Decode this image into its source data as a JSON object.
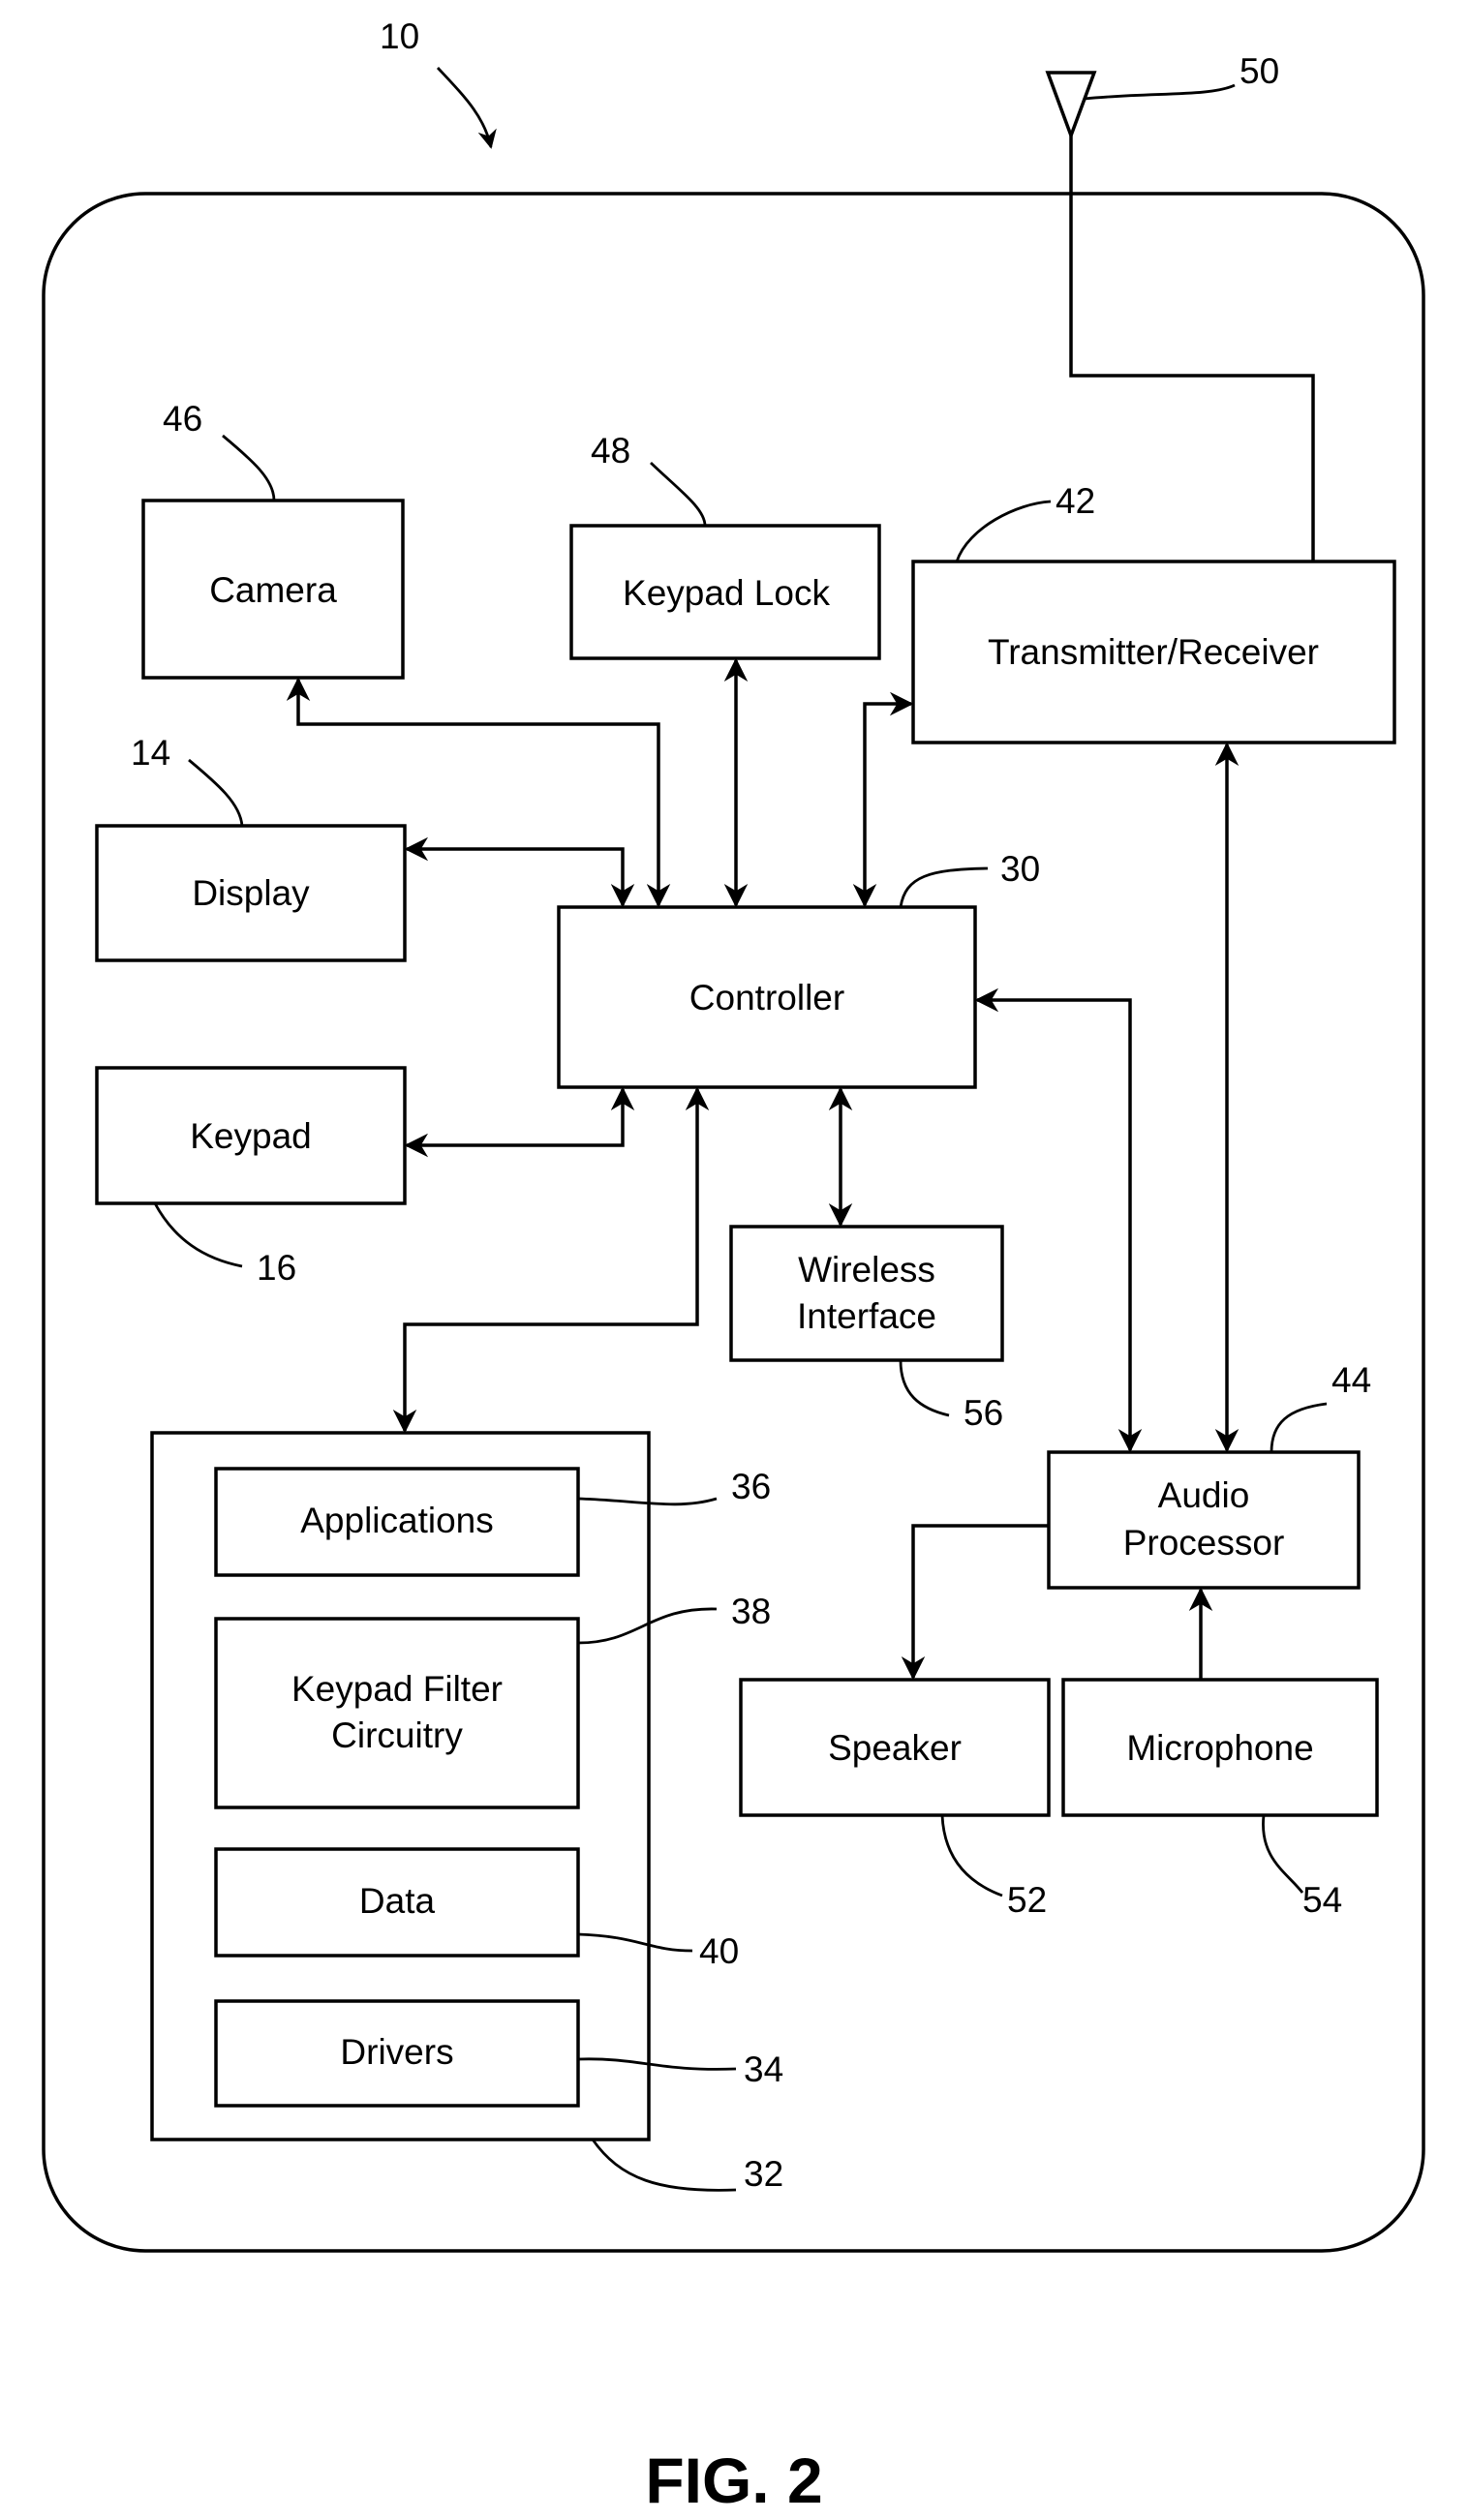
{
  "figure": {
    "caption": "FIG. 2",
    "device_ref": "10"
  },
  "antenna": {
    "ref": "50"
  },
  "blocks": {
    "camera": {
      "label": "Camera",
      "ref": "46"
    },
    "keypad_lock": {
      "label": "Keypad Lock",
      "ref": "48"
    },
    "transceiver": {
      "label": "Transmitter/Receiver",
      "ref": "42"
    },
    "display": {
      "label": "Display",
      "ref": "14"
    },
    "controller": {
      "label": "Controller",
      "ref": "30"
    },
    "keypad": {
      "label": "Keypad",
      "ref": "16"
    },
    "wireless": {
      "label_line1": "Wireless",
      "label_line2": "Interface",
      "ref": "56"
    },
    "memory": {
      "ref": "32"
    },
    "applications": {
      "label": "Applications",
      "ref": "36"
    },
    "keypad_filter": {
      "label_line1": "Keypad Filter",
      "label_line2": "Circuitry",
      "ref": "38"
    },
    "data": {
      "label": "Data",
      "ref": "40"
    },
    "drivers": {
      "label": "Drivers",
      "ref": "34"
    },
    "audio": {
      "label_line1": "Audio",
      "label_line2": "Processor",
      "ref": "44"
    },
    "speaker": {
      "label": "Speaker",
      "ref": "52"
    },
    "microphone": {
      "label": "Microphone",
      "ref": "54"
    }
  }
}
